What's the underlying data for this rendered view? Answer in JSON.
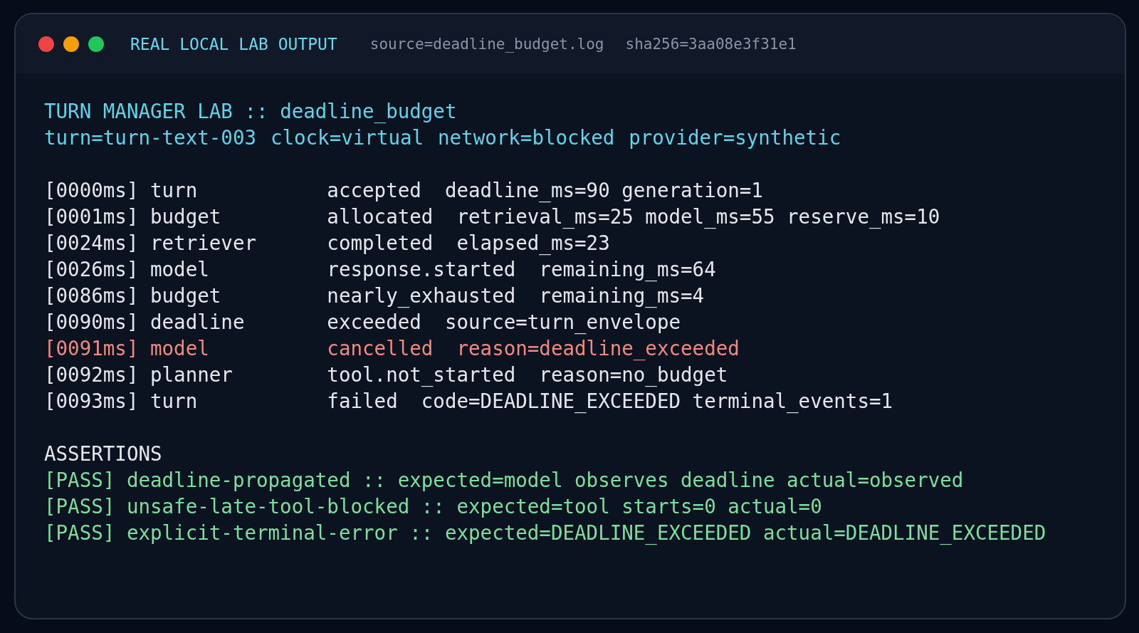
{
  "window": {
    "title": "REAL LOCAL LAB OUTPUT",
    "meta": [
      "source=deadline_budget.log",
      "sha256=3aa08e3f31e1"
    ]
  },
  "header": {
    "title": "TURN MANAGER LAB :: deadline_budget",
    "fields": [
      "turn=turn-text-003",
      "clock=virtual",
      "network=blocked",
      "provider=synthetic"
    ]
  },
  "log": [
    {
      "kind": "info",
      "time": "[0000ms]",
      "source": "turn",
      "event": "accepted",
      "details": "deadline_ms=90 generation=1"
    },
    {
      "kind": "info",
      "time": "[0001ms]",
      "source": "budget",
      "event": "allocated",
      "details": "retrieval_ms=25 model_ms=55 reserve_ms=10"
    },
    {
      "kind": "info",
      "time": "[0024ms]",
      "source": "retriever",
      "event": "completed",
      "details": "elapsed_ms=23"
    },
    {
      "kind": "info",
      "time": "[0026ms]",
      "source": "model",
      "event": "response.started",
      "details": "remaining_ms=64"
    },
    {
      "kind": "info",
      "time": "[0086ms]",
      "source": "budget",
      "event": "nearly_exhausted",
      "details": "remaining_ms=4"
    },
    {
      "kind": "info",
      "time": "[0090ms]",
      "source": "deadline",
      "event": "exceeded",
      "details": "source=turn_envelope"
    },
    {
      "kind": "error",
      "time": "[0091ms]",
      "source": "model",
      "event": "cancelled",
      "details": "reason=deadline_exceeded"
    },
    {
      "kind": "info",
      "time": "[0092ms]",
      "source": "planner",
      "event": "tool.not_started",
      "details": "reason=no_budget"
    },
    {
      "kind": "info",
      "time": "[0093ms]",
      "source": "turn",
      "event": "failed",
      "details": "code=DEADLINE_EXCEEDED terminal_events=1"
    }
  ],
  "assertions": {
    "heading": "ASSERTIONS",
    "items": [
      {
        "status": "[PASS]",
        "text": "deadline-propagated :: expected=model observes deadline actual=observed"
      },
      {
        "status": "[PASS]",
        "text": "unsafe-late-tool-blocked :: expected=tool starts=0 actual=0"
      },
      {
        "status": "[PASS]",
        "text": "explicit-terminal-error :: expected=DEADLINE_EXCEEDED actual=DEADLINE_EXCEEDED"
      }
    ]
  }
}
